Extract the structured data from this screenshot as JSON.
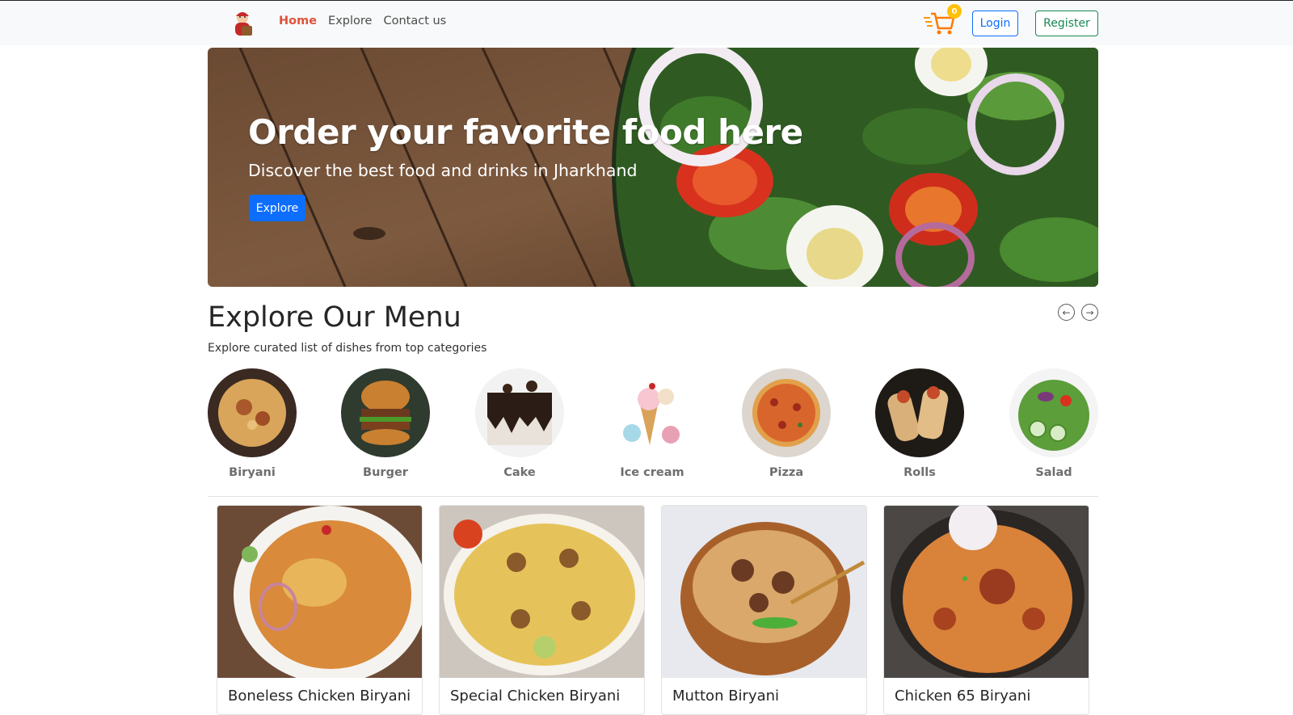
{
  "nav": {
    "links": [
      {
        "label": "Home",
        "active": true
      },
      {
        "label": "Explore",
        "active": false
      },
      {
        "label": "Contact us",
        "active": false
      }
    ],
    "cart_count": "0",
    "login_label": "Login",
    "register_label": "Register"
  },
  "hero": {
    "title": "Order your favorite food here",
    "subtitle": "Discover the best food and drinks in Jharkhand",
    "button_label": "Explore"
  },
  "menu": {
    "title": "Explore Our Menu",
    "subtitle": "Explore curated list of dishes from top categories",
    "categories": [
      {
        "label": "Biryani"
      },
      {
        "label": "Burger"
      },
      {
        "label": "Cake"
      },
      {
        "label": "Ice cream"
      },
      {
        "label": "Pizza"
      },
      {
        "label": "Rolls"
      },
      {
        "label": "Salad"
      }
    ]
  },
  "foods": [
    {
      "name": "Boneless Chicken Biryani"
    },
    {
      "name": "Special Chicken Biryani"
    },
    {
      "name": "Mutton Biryani"
    },
    {
      "name": "Chicken 65 Biryani"
    }
  ],
  "colors": {
    "accent": "#e1523a",
    "primary": "#0d6efd",
    "success": "#198754",
    "badge": "#ffc107"
  }
}
